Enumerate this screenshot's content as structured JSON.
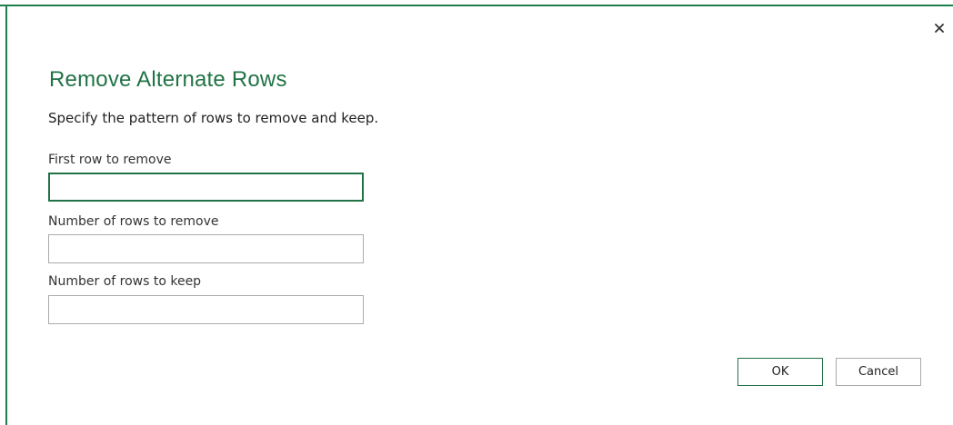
{
  "dialog": {
    "title": "Remove Alternate Rows",
    "subtitle": "Specify the pattern of rows to remove and keep.",
    "close_icon": "close-icon",
    "accent_color": "#217346"
  },
  "fields": [
    {
      "label": "First row to remove",
      "value": "",
      "focused": true
    },
    {
      "label": "Number of rows to remove",
      "value": ""
    },
    {
      "label": "Number of rows to keep",
      "value": ""
    }
  ],
  "buttons": {
    "ok_label": "OK",
    "cancel_label": "Cancel"
  }
}
